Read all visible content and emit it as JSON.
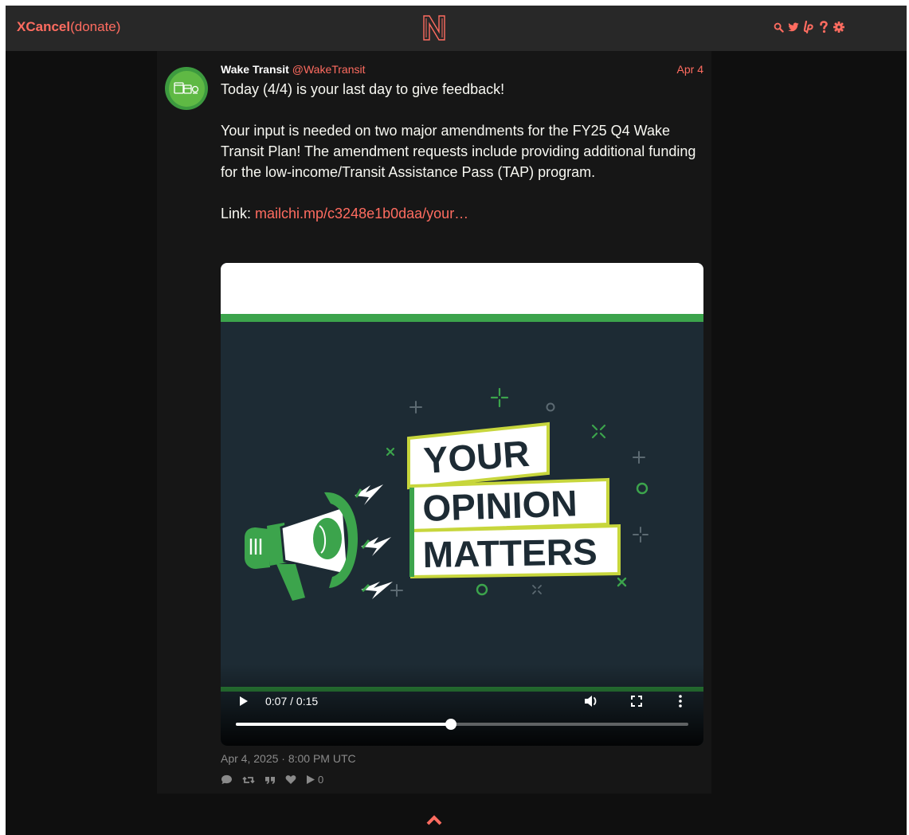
{
  "navbar": {
    "brand": "XCancel",
    "donate": "(donate)",
    "icons": [
      "search-icon",
      "twitter-bird-icon",
      "liberapay-icon",
      "help-icon",
      "settings-gear-icon"
    ]
  },
  "tweet": {
    "author_name": "Wake Transit",
    "author_handle": "@WakeTransit",
    "date": "Apr 4",
    "text_lines": [
      "Today (4/4) is your last day to give feedback!",
      "Your input is needed on two major amendments for the FY25 Q4 Wake Transit Plan!  The amendment requests include providing additional funding for the low-income/Transit Assistance Pass (TAP) program."
    ],
    "link_label": "Link: ",
    "link_text": "mailchi.mp/c3248e1b0daa/your…",
    "timestamp": "Apr 4, 2025 · 8:00 PM UTC",
    "views": "0"
  },
  "video": {
    "poster_text": [
      "YOUR",
      "OPINION",
      "MATTERS"
    ],
    "time": "0:07 / 0:15",
    "progress_fraction": 0.476
  },
  "colors": {
    "accent": "#ff6c60",
    "brand_green": "#3ca44c",
    "bg": "#0f0f0f",
    "panel": "#161616",
    "nav": "#282828"
  }
}
